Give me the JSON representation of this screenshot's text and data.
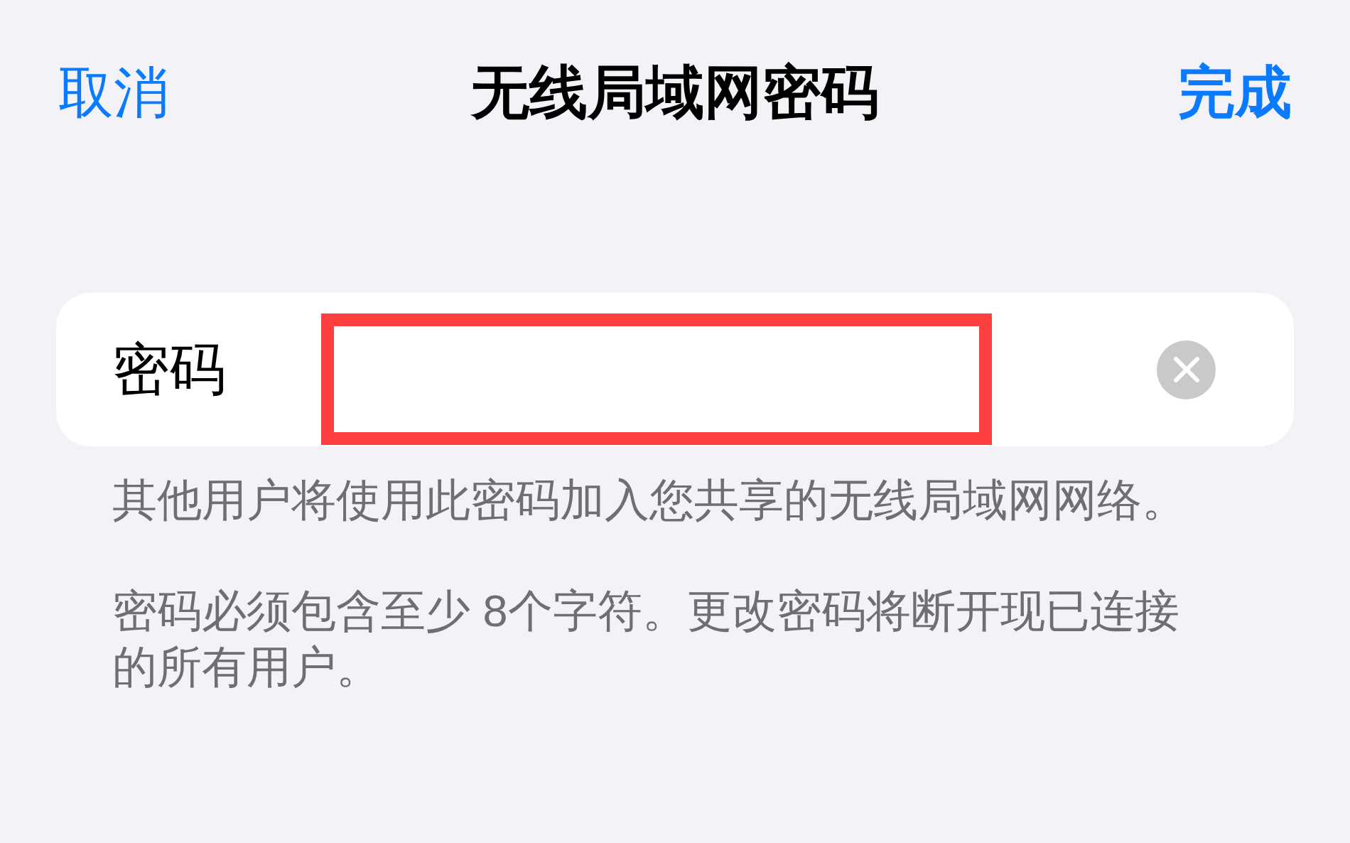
{
  "nav_bar": {
    "cancel_button": "取消",
    "title": "无线局域网密码",
    "done_button": "完成"
  },
  "password_field": {
    "label": "密码",
    "redacted": true,
    "clear_button": true
  },
  "footer_notes": [
    "其他用户将使用此密码加入您共享的无线局域网网络。",
    "密码必须包含至少 8个字符。更改密码将断开现已连接的所有用户。"
  ]
}
